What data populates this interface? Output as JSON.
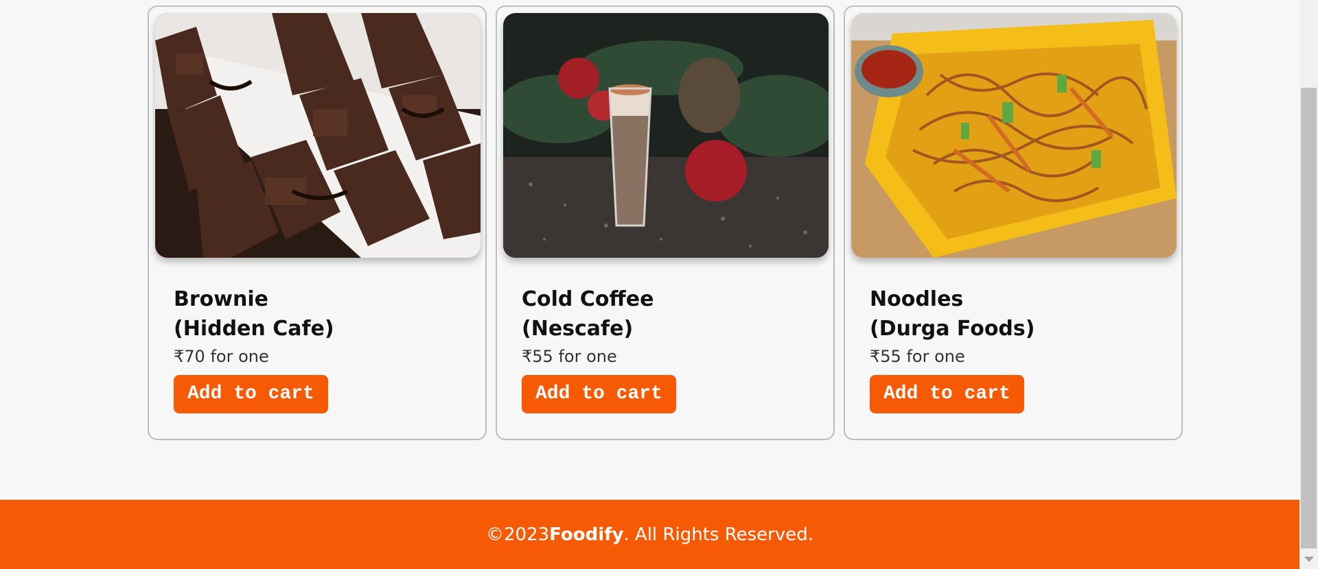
{
  "products": [
    {
      "name": "Brownie",
      "vendor": "(Hidden Cafe)",
      "price": "₹70 for one",
      "button_label": "Add to cart",
      "image": "brownie-image"
    },
    {
      "name": "Cold Coffee",
      "vendor": "(Nescafe)",
      "price": "₹55 for one",
      "button_label": "Add to cart",
      "image": "cold-coffee-image"
    },
    {
      "name": "Noodles",
      "vendor": "(Durga Foods)",
      "price": "₹55 for one",
      "button_label": "Add to cart",
      "image": "noodles-image"
    }
  ],
  "footer": {
    "copyright": "©2023 ",
    "brand": "Foodify",
    "rights": ". All Rights Reserved."
  },
  "colors": {
    "accent": "#f75a05",
    "background": "#f7f7f8",
    "card_border": "#bdbdbd"
  }
}
